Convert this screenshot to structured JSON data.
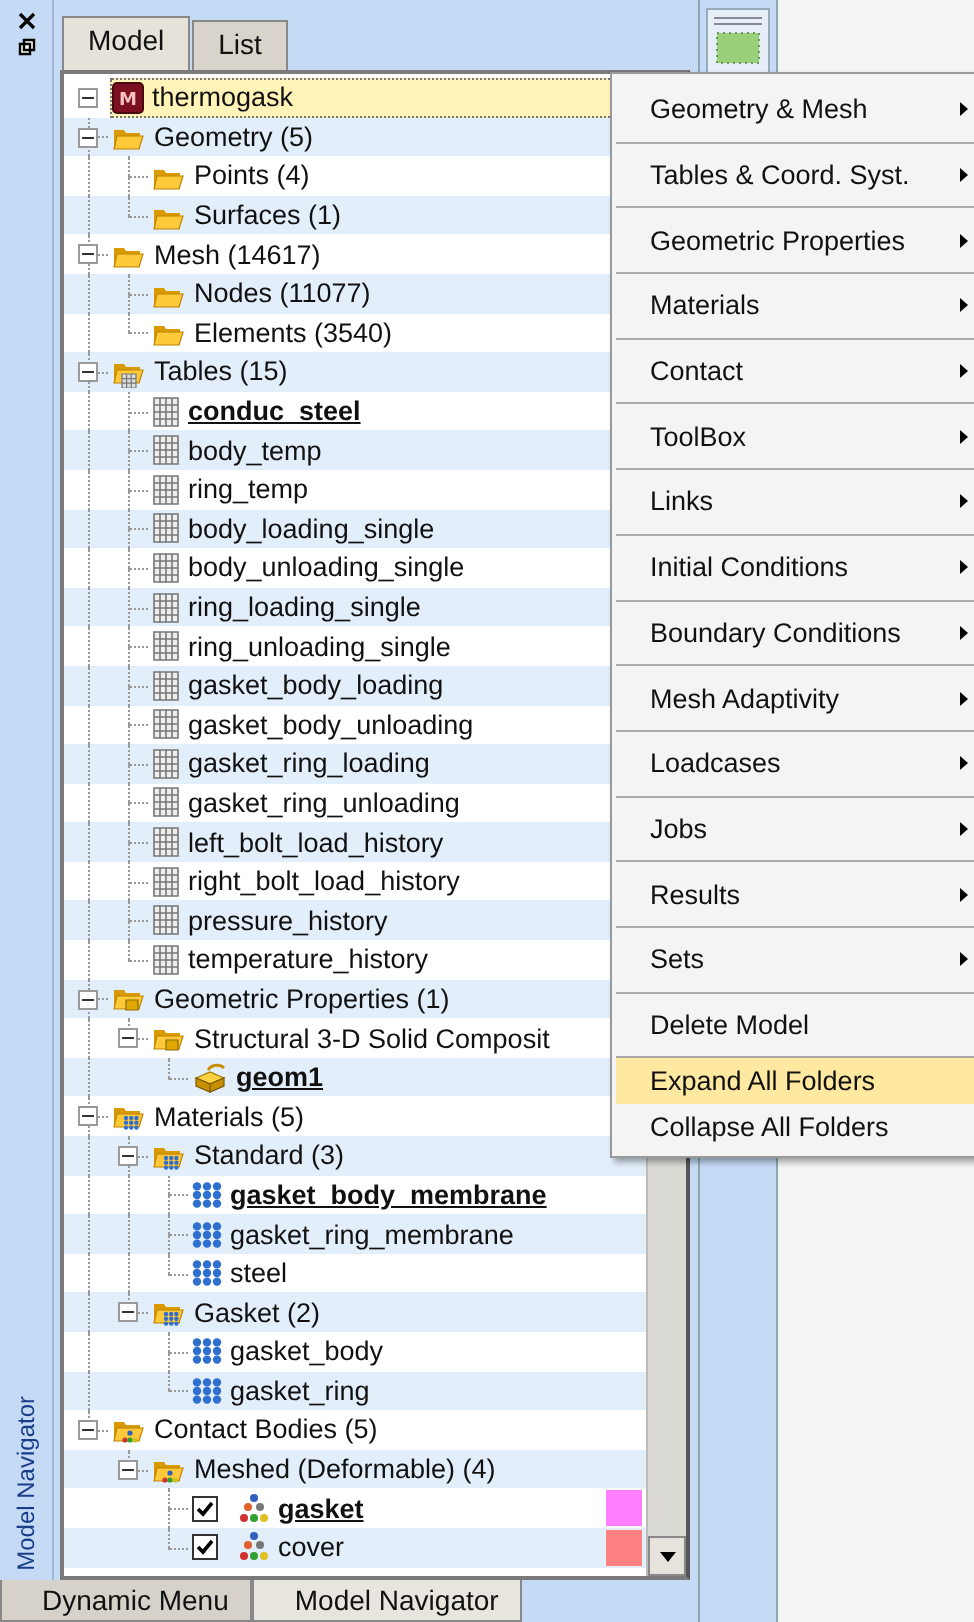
{
  "side_strip": {
    "label": "Model Navigator"
  },
  "tabs": [
    {
      "label": "Model",
      "selected": true
    },
    {
      "label": "List",
      "selected": false
    }
  ],
  "tree": [
    {
      "label": "thermogask",
      "kind": "model",
      "badge": "M",
      "selected": true,
      "expanded": true,
      "children": [
        {
          "label": "Geometry (5)",
          "kind": "folder",
          "expanded": true,
          "children": [
            {
              "label": "Points (4)",
              "kind": "folder"
            },
            {
              "label": "Surfaces (1)",
              "kind": "folder"
            }
          ]
        },
        {
          "label": "Mesh (14617)",
          "kind": "folder",
          "expanded": true,
          "children": [
            {
              "label": "Nodes (11077)",
              "kind": "folder"
            },
            {
              "label": "Elements (3540)",
              "kind": "folder"
            }
          ]
        },
        {
          "label": "Tables (15)",
          "kind": "tables",
          "expanded": true,
          "children": [
            {
              "label": "conduc_steel",
              "kind": "table",
              "current": true
            },
            {
              "label": "body_temp",
              "kind": "table"
            },
            {
              "label": "ring_temp",
              "kind": "table"
            },
            {
              "label": "body_loading_single",
              "kind": "table"
            },
            {
              "label": "body_unloading_single",
              "kind": "table"
            },
            {
              "label": "ring_loading_single",
              "kind": "table"
            },
            {
              "label": "ring_unloading_single",
              "kind": "table"
            },
            {
              "label": "gasket_body_loading",
              "kind": "table"
            },
            {
              "label": "gasket_body_unloading",
              "kind": "table"
            },
            {
              "label": "gasket_ring_loading",
              "kind": "table"
            },
            {
              "label": "gasket_ring_unloading",
              "kind": "table"
            },
            {
              "label": "left_bolt_load_history",
              "kind": "table"
            },
            {
              "label": "right_bolt_load_history",
              "kind": "table"
            },
            {
              "label": "pressure_history",
              "kind": "table"
            },
            {
              "label": "temperature_history",
              "kind": "table"
            }
          ]
        },
        {
          "label": "Geometric Properties (1)",
          "kind": "properties",
          "expanded": true,
          "children": [
            {
              "label": "Structural 3-D Solid Composit",
              "kind": "properties",
              "expanded": true,
              "children": [
                {
                  "label": "geom1",
                  "kind": "property",
                  "current": true
                }
              ]
            }
          ]
        },
        {
          "label": "Materials (5)",
          "kind": "materials",
          "expanded": true,
          "children": [
            {
              "label": "Standard (3)",
              "kind": "materials",
              "expanded": true,
              "children": [
                {
                  "label": "gasket_body_membrane",
                  "kind": "material",
                  "current": true
                },
                {
                  "label": "gasket_ring_membrane",
                  "kind": "material"
                },
                {
                  "label": "steel",
                  "kind": "material"
                }
              ]
            },
            {
              "label": "Gasket (2)",
              "kind": "materials",
              "expanded": true,
              "children": [
                {
                  "label": "gasket_body",
                  "kind": "material"
                },
                {
                  "label": "gasket_ring",
                  "kind": "material"
                }
              ]
            }
          ]
        },
        {
          "label": "Contact Bodies (5)",
          "kind": "contacts",
          "expanded": true,
          "children": [
            {
              "label": "Meshed (Deformable) (4)",
              "kind": "contacts",
              "expanded": true,
              "children": [
                {
                  "label": "gasket",
                  "kind": "body",
                  "current": true,
                  "checked": true,
                  "color": "#ff80ff"
                },
                {
                  "label": "cover",
                  "kind": "body",
                  "checked": true,
                  "color": "#ff8080"
                }
              ]
            }
          ]
        }
      ]
    }
  ],
  "context_menu": [
    {
      "label": "Geometry & Mesh",
      "submenu": true,
      "selected": false
    },
    {
      "label": "Tables & Coord. Syst.",
      "submenu": true,
      "selected": false
    },
    {
      "label": "Geometric Properties",
      "submenu": true,
      "selected": false
    },
    {
      "label": "Materials",
      "submenu": true,
      "selected": false
    },
    {
      "label": "Contact",
      "submenu": true,
      "selected": false
    },
    {
      "label": "ToolBox",
      "submenu": true,
      "selected": false
    },
    {
      "label": "Links",
      "submenu": true,
      "selected": false
    },
    {
      "label": "Initial Conditions",
      "submenu": true,
      "selected": false
    },
    {
      "label": "Boundary Conditions",
      "submenu": true,
      "selected": false
    },
    {
      "label": "Mesh Adaptivity",
      "submenu": true,
      "selected": false
    },
    {
      "label": "Loadcases",
      "submenu": true,
      "selected": false
    },
    {
      "label": "Jobs",
      "submenu": true,
      "selected": false
    },
    {
      "label": "Results",
      "submenu": true,
      "selected": false
    },
    {
      "label": "Sets",
      "submenu": true,
      "selected": false
    },
    {
      "label": "Delete Model",
      "submenu": false,
      "selected": false
    },
    {
      "label": "Expand All Folders",
      "submenu": false,
      "selected": true,
      "compact": true
    },
    {
      "label": "Collapse All Folders",
      "submenu": false,
      "selected": false,
      "compact": true
    }
  ],
  "bottom_tabs": [
    {
      "label": "Dynamic Menu",
      "selected": false
    },
    {
      "label": "Model Navigator",
      "selected": true
    }
  ]
}
